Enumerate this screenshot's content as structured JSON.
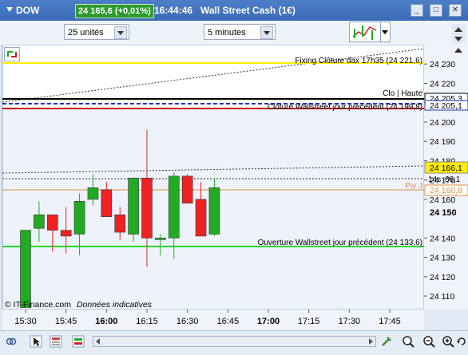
{
  "window": {
    "symbol": "DOW",
    "price_badge": "24 165,6 (+0,01%)",
    "time": "16:44:46",
    "instrument": "Wall Street Cash (1€)",
    "buttons": {
      "minimize": "_",
      "maximize": "□",
      "close": "✕"
    }
  },
  "toolbar": {
    "units": "25 unités",
    "interval": "5 minutes"
  },
  "chart": {
    "copyright": "© IT-Finance.com",
    "indicative": "Données indicatives",
    "annotations": {
      "fixing": "Fixing Clôture dax 17h35 (24 221,6)",
      "clo_haute": "Clo | Haute",
      "cloture_prev": "Clôture Wallstreet jour précédent (24 199,8)",
      "piv": "Piv J",
      "countdown": "14s",
      "ouverture_prev": "Ouverture Wallstreet jour précédent (24 133,6)"
    },
    "price_labels": {
      "l205_3": "24 205,3",
      "l205_1": "24 205,1",
      "current": "24 166,1",
      "countdown_val": "66,1",
      "piv": "24 160,8",
      "bold": "24 150"
    },
    "colors": {
      "up": "#22aa22",
      "down": "#ee2222",
      "fixing": "#f0f000",
      "prev_close": "#2020c0",
      "ouverture": "#22dd22",
      "piv": "#e09040",
      "high": "#000000"
    }
  },
  "chart_data": {
    "type": "candlestick",
    "ylim": [
      24103,
      24240
    ],
    "yticks": [
      "24 230",
      "24 220",
      "24 210",
      "24 200",
      "24 190",
      "24 180",
      "24 170",
      "24 160",
      "24 150",
      "24 140",
      "24 130",
      "24 120",
      "24 110"
    ],
    "yticks_values": [
      24230,
      24220,
      24210,
      24200,
      24190,
      24180,
      24170,
      24160,
      24150,
      24140,
      24130,
      24120,
      24110
    ],
    "xticks": [
      "15:30",
      "15:45",
      "16:00",
      "16:15",
      "16:30",
      "16:45",
      "17:00",
      "17:15",
      "17:30",
      "17:45"
    ],
    "bold_xticks": [
      "16:00",
      "17:00"
    ],
    "candles": [
      {
        "o": 24104,
        "h": 24144,
        "l": 24104,
        "c": 24144
      },
      {
        "o": 24145,
        "h": 24159,
        "l": 24138,
        "c": 24152
      },
      {
        "o": 24152,
        "h": 24152,
        "l": 24133,
        "c": 24144
      },
      {
        "o": 24144,
        "h": 24156,
        "l": 24132,
        "c": 24141
      },
      {
        "o": 24142,
        "h": 24163,
        "l": 24131,
        "c": 24159
      },
      {
        "o": 24160,
        "h": 24173,
        "l": 24157,
        "c": 24166
      },
      {
        "o": 24165,
        "h": 24169,
        "l": 24151,
        "c": 24151
      },
      {
        "o": 24152,
        "h": 24156,
        "l": 24139,
        "c": 24143
      },
      {
        "o": 24142,
        "h": 24168,
        "l": 24138,
        "c": 24171
      },
      {
        "o": 24171,
        "h": 24196,
        "l": 24125,
        "c": 24140
      },
      {
        "o": 24140,
        "h": 24142,
        "l": 24131,
        "c": 24140
      },
      {
        "o": 24140,
        "h": 24174,
        "l": 24129,
        "c": 24172
      },
      {
        "o": 24172,
        "h": 24173,
        "l": 24158,
        "c": 24158
      },
      {
        "o": 24160,
        "h": 24169,
        "l": 24141,
        "c": 24141
      },
      {
        "o": 24142,
        "h": 24171,
        "l": 24141,
        "c": 24166
      }
    ]
  },
  "statusbar": {
    "icons": [
      "link-icon",
      "arrow-icon",
      "table-icon",
      "layers-icon",
      "tool-icon",
      "zoom-fit-icon",
      "zoom-in-icon",
      "zoom-out-icon",
      "refresh-icon"
    ]
  }
}
